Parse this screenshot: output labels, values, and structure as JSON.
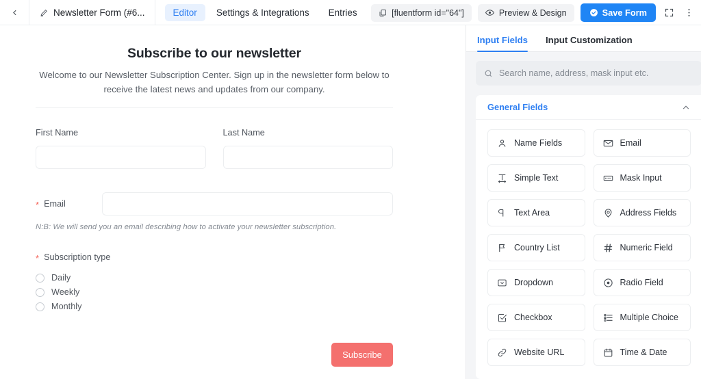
{
  "header": {
    "back_icon": "chevron-left-icon",
    "form_title": "Newsletter Form (#6...",
    "pencil_icon": "pencil-icon",
    "tabs": [
      {
        "label": "Editor",
        "active": true
      },
      {
        "label": "Settings & Integrations",
        "active": false
      },
      {
        "label": "Entries",
        "active": false
      }
    ],
    "shortcode": "[fluentform id=\"64\"]",
    "shortcode_icon": "copy-icon",
    "preview_label": "Preview & Design",
    "preview_icon": "eye-icon",
    "save_label": "Save Form",
    "save_icon": "check-circle-icon",
    "expand_icon": "fullscreen-icon",
    "more_icon": "more-vertical-icon",
    "accent_blue": "#1f85f5",
    "tab_active_bg": "#e8f1fe"
  },
  "form": {
    "title": "Subscribe to our newsletter",
    "subtitle": "Welcome to our Newsletter Subscription Center. Sign up in the newsletter form below to receive the latest news and updates from our company.",
    "first_name": {
      "label": "First Name",
      "value": "",
      "required": false
    },
    "last_name": {
      "label": "Last Name",
      "value": "",
      "required": false
    },
    "email": {
      "label": "Email",
      "value": "",
      "required": true,
      "required_mark": "*"
    },
    "email_note": "N:B: We will send you an email describing how to activate your newsletter subscription.",
    "subscription": {
      "label": "Subscription type",
      "required": true,
      "required_mark": "*",
      "options": [
        {
          "label": "Daily",
          "selected": false
        },
        {
          "label": "Weekly",
          "selected": false
        },
        {
          "label": "Monthly",
          "selected": false
        }
      ]
    },
    "submit_label": "Subscribe",
    "submit_color": "#f4706e",
    "required_color": "#f5655b"
  },
  "panel": {
    "tabs": [
      {
        "label": "Input Fields",
        "active": true
      },
      {
        "label": "Input Customization",
        "active": false
      }
    ],
    "search_placeholder": "Search name, address, mask input etc.",
    "search_icon": "search-icon",
    "search_value": "",
    "group": {
      "title": "General Fields",
      "collapse_icon": "chevron-up-icon",
      "title_color": "#2e7ff2",
      "fields": [
        {
          "label": "Name Fields",
          "icon": "user-icon"
        },
        {
          "label": "Email",
          "icon": "envelope-icon"
        },
        {
          "label": "Simple Text",
          "icon": "text-width-icon"
        },
        {
          "label": "Mask Input",
          "icon": "mask-input-icon"
        },
        {
          "label": "Text Area",
          "icon": "paragraph-icon"
        },
        {
          "label": "Address Fields",
          "icon": "map-pin-icon"
        },
        {
          "label": "Country List",
          "icon": "flag-icon"
        },
        {
          "label": "Numeric Field",
          "icon": "hash-icon"
        },
        {
          "label": "Dropdown",
          "icon": "dropdown-icon"
        },
        {
          "label": "Radio Field",
          "icon": "radio-circle-icon"
        },
        {
          "label": "Checkbox",
          "icon": "checkbox-icon"
        },
        {
          "label": "Multiple Choice",
          "icon": "list-icon"
        },
        {
          "label": "Website URL",
          "icon": "link-icon"
        },
        {
          "label": "Time & Date",
          "icon": "calendar-icon"
        }
      ]
    }
  }
}
